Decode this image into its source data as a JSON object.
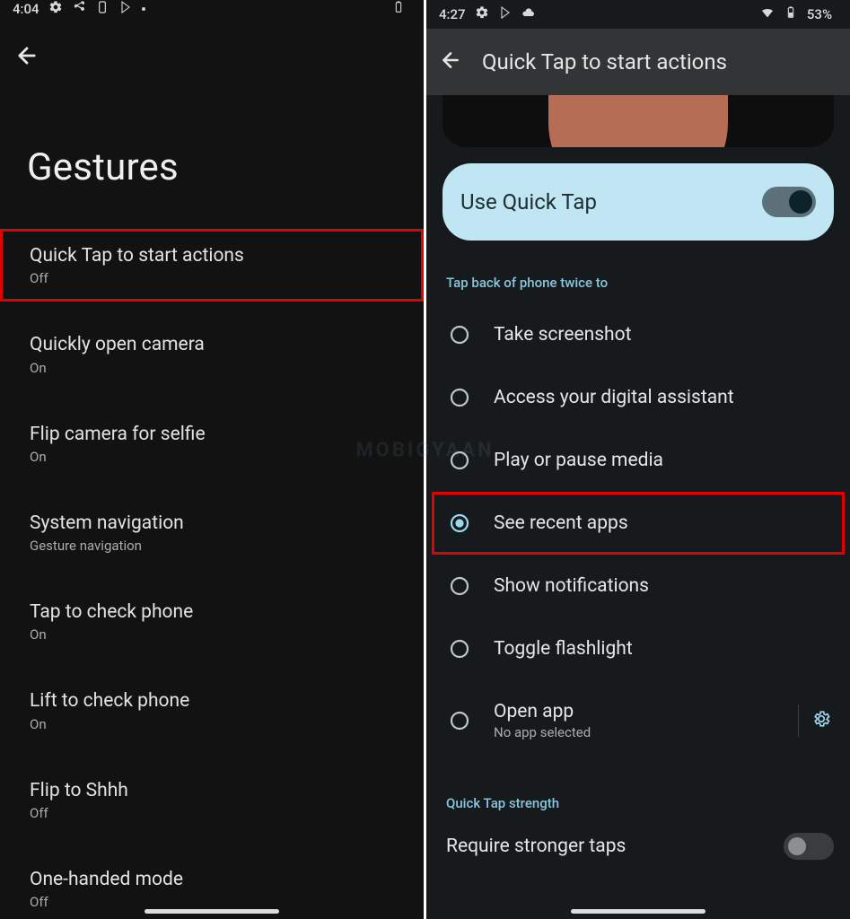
{
  "watermark": "MOBIGYAAN",
  "left": {
    "statusbar": {
      "time": "4:04"
    },
    "title": "Gestures",
    "items": [
      {
        "title": "Quick Tap to start actions",
        "sub": "Off",
        "highlight": true
      },
      {
        "title": "Quickly open camera",
        "sub": "On"
      },
      {
        "title": "Flip camera for selfie",
        "sub": "On"
      },
      {
        "title": "System navigation",
        "sub": "Gesture navigation"
      },
      {
        "title": "Tap to check phone",
        "sub": "On"
      },
      {
        "title": "Lift to check phone",
        "sub": "On"
      },
      {
        "title": "Flip to Shhh",
        "sub": "Off"
      },
      {
        "title": "One-handed mode",
        "sub": "Off"
      }
    ]
  },
  "right": {
    "statusbar": {
      "time": "4:27",
      "battery": "53%"
    },
    "appbar_title": "Quick Tap to start actions",
    "use_quick_tap_label": "Use Quick Tap",
    "use_quick_tap_on": true,
    "section_label": "Tap back of phone twice to",
    "options": [
      {
        "label": "Take screenshot"
      },
      {
        "label": "Access your digital assistant"
      },
      {
        "label": "Play or pause media"
      },
      {
        "label": "See recent apps",
        "selected": true,
        "highlight": true
      },
      {
        "label": "Show notifications"
      },
      {
        "label": "Toggle flashlight"
      },
      {
        "label": "Open app",
        "sub": "No app selected",
        "gear": true
      }
    ],
    "strength_section_label": "Quick Tap strength",
    "stronger_taps_label": "Require stronger taps",
    "stronger_taps_on": false
  }
}
